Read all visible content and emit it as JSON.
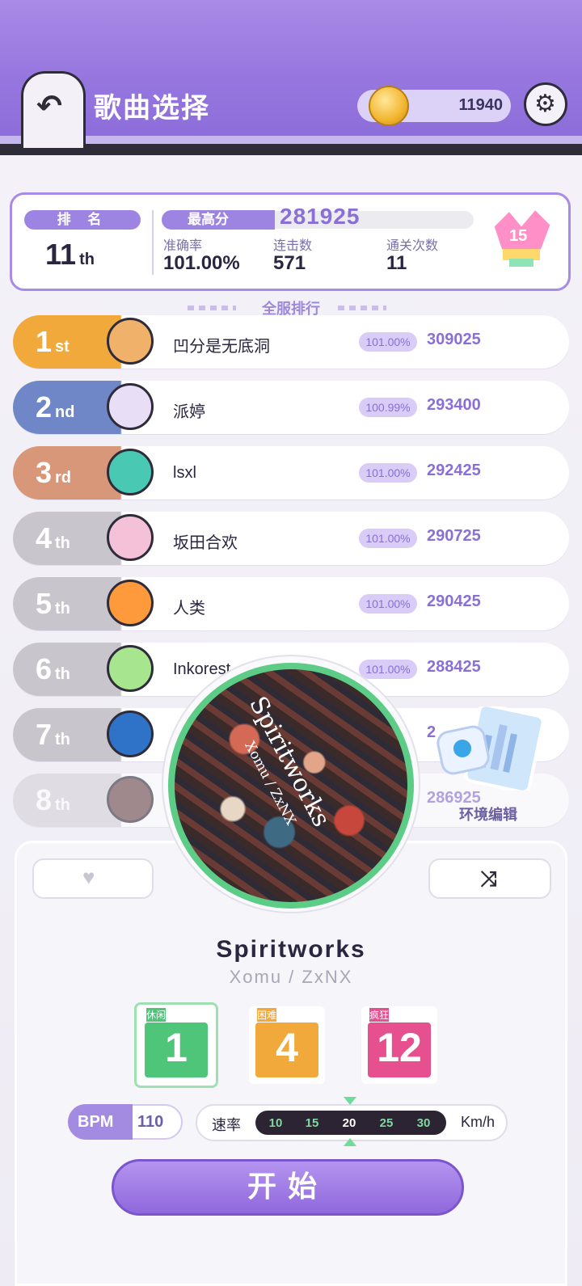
{
  "header": {
    "title": "歌曲选择",
    "coins": "11940"
  },
  "player": {
    "rank_label": "排 名",
    "rank": "11",
    "rank_suffix": "th",
    "best_label": "最高分",
    "best_score": "281925",
    "accuracy_label": "准确率",
    "accuracy": "101.00%",
    "combo_label": "连击数",
    "combo": "571",
    "clears_label": "通关次数",
    "clears": "11",
    "badge_icon": "trophy-stamp-icon"
  },
  "leaderboard": {
    "title": "全服排行",
    "rows": [
      {
        "place": "1",
        "suffix": "st",
        "name": "凹分是无底洞",
        "accuracy": "101.00%",
        "score": "309025",
        "color": "#f2a93b"
      },
      {
        "place": "2",
        "suffix": "nd",
        "name": "派婷",
        "accuracy": "100.99%",
        "score": "293400",
        "color": "#6f87c7"
      },
      {
        "place": "3",
        "suffix": "rd",
        "name": "lsxl",
        "accuracy": "101.00%",
        "score": "292425",
        "color": "#d9977a"
      },
      {
        "place": "4",
        "suffix": "th",
        "name": "坂田合欢",
        "accuracy": "101.00%",
        "score": "290725",
        "color": "#c8c6cc"
      },
      {
        "place": "5",
        "suffix": "th",
        "name": "人类",
        "accuracy": "101.00%",
        "score": "290425",
        "color": "#c8c6cc"
      },
      {
        "place": "6",
        "suffix": "th",
        "name": "Inkorest",
        "accuracy": "101.00%",
        "score": "288425",
        "color": "#c8c6cc"
      },
      {
        "place": "7",
        "suffix": "th",
        "name": "",
        "accuracy": "",
        "score": "2",
        "color": "#c8c6cc"
      },
      {
        "place": "8",
        "suffix": "th",
        "name": "",
        "accuracy": "",
        "score": "286925",
        "color": "#d4d2d8"
      }
    ]
  },
  "env_edit": {
    "label": "环境编辑"
  },
  "song": {
    "title": "Spiritworks",
    "artist": "Xomu / ZxNX",
    "cover_title": "Spiritworks",
    "cover_artist": "Xomu / ZxNX"
  },
  "difficulty": [
    {
      "label": "休闲",
      "level": "1",
      "color": "#4fc57a"
    },
    {
      "label": "困难",
      "level": "4",
      "color": "#f2a93b"
    },
    {
      "label": "疯狂",
      "level": "12",
      "color": "#e6508f"
    }
  ],
  "bpm": {
    "label": "BPM",
    "value": "110"
  },
  "speed": {
    "label": "速率",
    "options": [
      "10",
      "15",
      "20",
      "25",
      "30"
    ],
    "selected": "20",
    "unit": "Km/h"
  },
  "start": {
    "label": "开始"
  }
}
